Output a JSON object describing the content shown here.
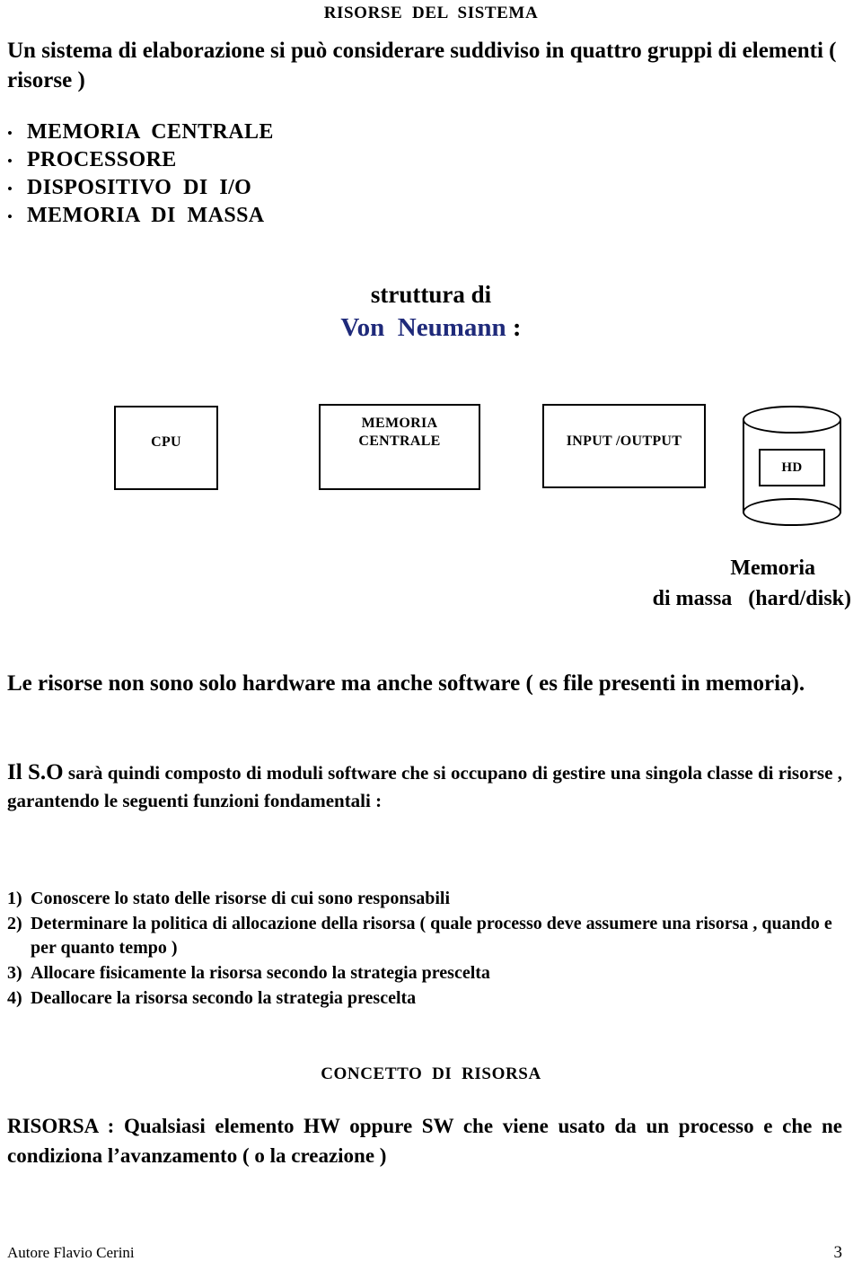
{
  "document": {
    "title": "RISORSE  DEL  SISTEMA",
    "intro": "Un sistema di elaborazione si può considerare suddiviso in quattro gruppi di elementi ( risorse )",
    "bullets": [
      {
        "marker": "•",
        "label": "MEMORIA  CENTRALE"
      },
      {
        "marker": "•",
        "label": "PROCESSORE"
      },
      {
        "marker": "•",
        "label": "DISPOSITIVO  DI  I/O"
      },
      {
        "marker": "•",
        "label": "MEMORIA  DI  MASSA"
      }
    ]
  },
  "diagram": {
    "heading_line1": "struttura di",
    "heading_line2_name": "Von  Neumann",
    "heading_line2_colon": " :",
    "name_color": "#1f2a7a",
    "boxes": [
      {
        "id": "cpu",
        "label": "CPU"
      },
      {
        "id": "memoria-centrale",
        "label": "MEMORIA\nCENTRALE"
      },
      {
        "id": "input-output",
        "label": "INPUT /OUTPUT"
      }
    ],
    "storage": {
      "inner_label": "HD",
      "caption_line1": "Memoria",
      "caption_line2": "di massa   (hard/disk)"
    }
  },
  "body": {
    "paragraph_risorse": "Le risorse non sono solo hardware ma anche software  ( es file presenti in memoria).",
    "paragraph_so_lead": "Il S.O",
    "paragraph_so_rest": " sarà quindi composto di moduli software che si occupano di gestire una singola classe di risorse , garantendo le seguenti funzioni fondamentali :",
    "numbered_list": [
      {
        "marker": "1)",
        "text": "Conoscere lo stato delle risorse di cui sono responsabili"
      },
      {
        "marker": "2)",
        "text": "Determinare la politica di allocazione della risorsa ( quale processo deve assumere una risorsa , quando e per quanto tempo )"
      },
      {
        "marker": "3)",
        "text": "Allocare fisicamente la risorsa secondo la strategia prescelta"
      },
      {
        "marker": "4)",
        "text": "Deallocare la risorsa secondo la strategia prescelta"
      }
    ],
    "section_heading": "CONCETTO  DI  RISORSA",
    "paragraph_risorsa": "RISORSA : Qualsiasi elemento HW oppure SW che viene usato da un processo e che ne condiziona l’avanzamento ( o la creazione  )"
  },
  "footer": {
    "author": "Autore Flavio Cerini",
    "page_number": "3"
  }
}
